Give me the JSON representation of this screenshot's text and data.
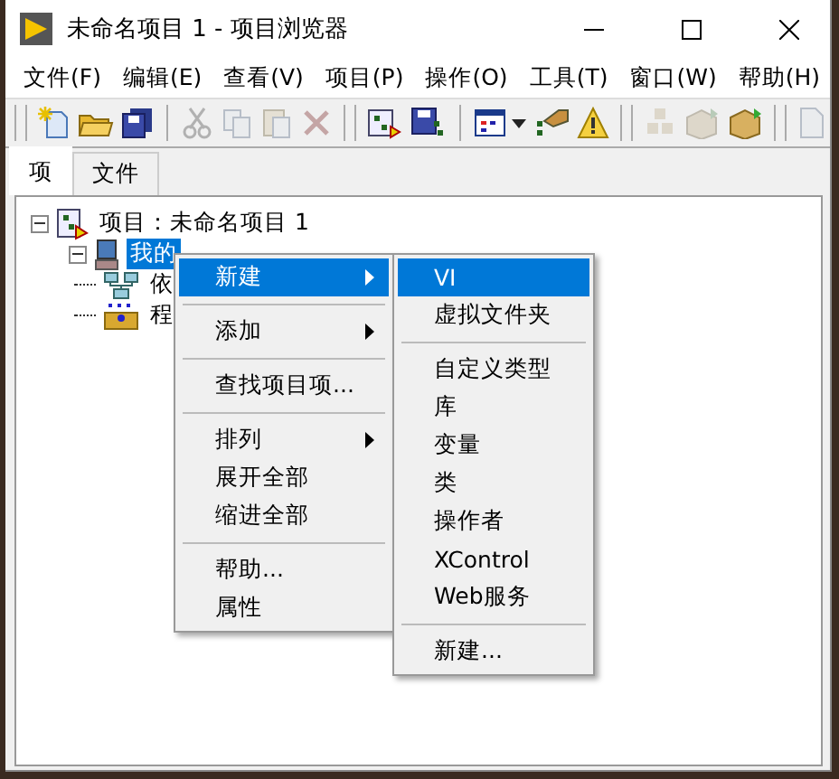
{
  "window": {
    "title": "未命名项目 1 - 项目浏览器"
  },
  "menu_bar": [
    "文件(F)",
    "编辑(E)",
    "查看(V)",
    "项目(P)",
    "操作(O)",
    "工具(T)",
    "窗口(W)",
    "帮助(H)"
  ],
  "toolbar": [
    {
      "items": [
        {
          "kind": "new",
          "disabled": false
        },
        {
          "kind": "open",
          "disabled": false
        },
        {
          "kind": "save-all",
          "disabled": false
        },
        {
          "kind": "separator"
        },
        {
          "kind": "cut",
          "disabled": true
        },
        {
          "kind": "copy",
          "disabled": true
        },
        {
          "kind": "paste",
          "disabled": true
        },
        {
          "kind": "delete",
          "disabled": true
        }
      ]
    },
    {
      "items": [
        {
          "kind": "project",
          "disabled": false
        },
        {
          "kind": "save",
          "disabled": false
        },
        {
          "kind": "separator"
        },
        {
          "kind": "window",
          "disabled": false
        },
        {
          "kind": "caret",
          "disabled": false
        },
        {
          "kind": "tool",
          "disabled": false
        },
        {
          "kind": "warning",
          "disabled": false
        }
      ]
    },
    {
      "items": [
        {
          "kind": "boxes",
          "disabled": true
        },
        {
          "kind": "box",
          "disabled": true
        },
        {
          "kind": "box",
          "disabled": false
        }
      ]
    },
    {
      "items": [
        {
          "kind": "doc",
          "disabled": true
        }
      ]
    }
  ],
  "tabs": [
    {
      "label": "项",
      "selected": true
    },
    {
      "label": "文件",
      "selected": false
    }
  ],
  "tree": [
    {
      "label": "项目：未命名项目 1",
      "kind": "project",
      "expanded": true,
      "selected": false,
      "children": [
        {
          "label": "我的",
          "kind": "computer",
          "expanded": true,
          "selected": true,
          "children": [
            {
              "label": "依",
              "kind": "dependencies",
              "selected": false
            },
            {
              "label": "程",
              "kind": "build",
              "selected": false
            }
          ]
        }
      ]
    }
  ],
  "context_menu": {
    "items": [
      {
        "kind": "item",
        "label": "新建",
        "submenu": true,
        "selected": true
      },
      {
        "kind": "separator"
      },
      {
        "kind": "item",
        "label": "添加",
        "submenu": true,
        "selected": false
      },
      {
        "kind": "separator"
      },
      {
        "kind": "item",
        "label": "查找项目项...",
        "submenu": false,
        "selected": false
      },
      {
        "kind": "separator"
      },
      {
        "kind": "item",
        "label": "排列",
        "submenu": true,
        "selected": false
      },
      {
        "kind": "item",
        "label": "展开全部",
        "submenu": false,
        "selected": false
      },
      {
        "kind": "item",
        "label": "缩进全部",
        "submenu": false,
        "selected": false
      },
      {
        "kind": "separator"
      },
      {
        "kind": "item",
        "label": "帮助...",
        "submenu": false,
        "selected": false
      },
      {
        "kind": "item",
        "label": "属性",
        "submenu": false,
        "selected": false
      }
    ]
  },
  "submenu": {
    "items": [
      {
        "kind": "item",
        "label": "VI",
        "selected": true
      },
      {
        "kind": "item",
        "label": "虚拟文件夹",
        "selected": false
      },
      {
        "kind": "separator"
      },
      {
        "kind": "item",
        "label": "自定义类型",
        "selected": false
      },
      {
        "kind": "item",
        "label": "库",
        "selected": false
      },
      {
        "kind": "item",
        "label": "变量",
        "selected": false
      },
      {
        "kind": "item",
        "label": "类",
        "selected": false
      },
      {
        "kind": "item",
        "label": "操作者",
        "selected": false
      },
      {
        "kind": "item",
        "label": "XControl",
        "selected": false
      },
      {
        "kind": "item",
        "label": "Web服务",
        "selected": false
      },
      {
        "kind": "separator"
      },
      {
        "kind": "item",
        "label": "新建...",
        "selected": false
      }
    ]
  }
}
